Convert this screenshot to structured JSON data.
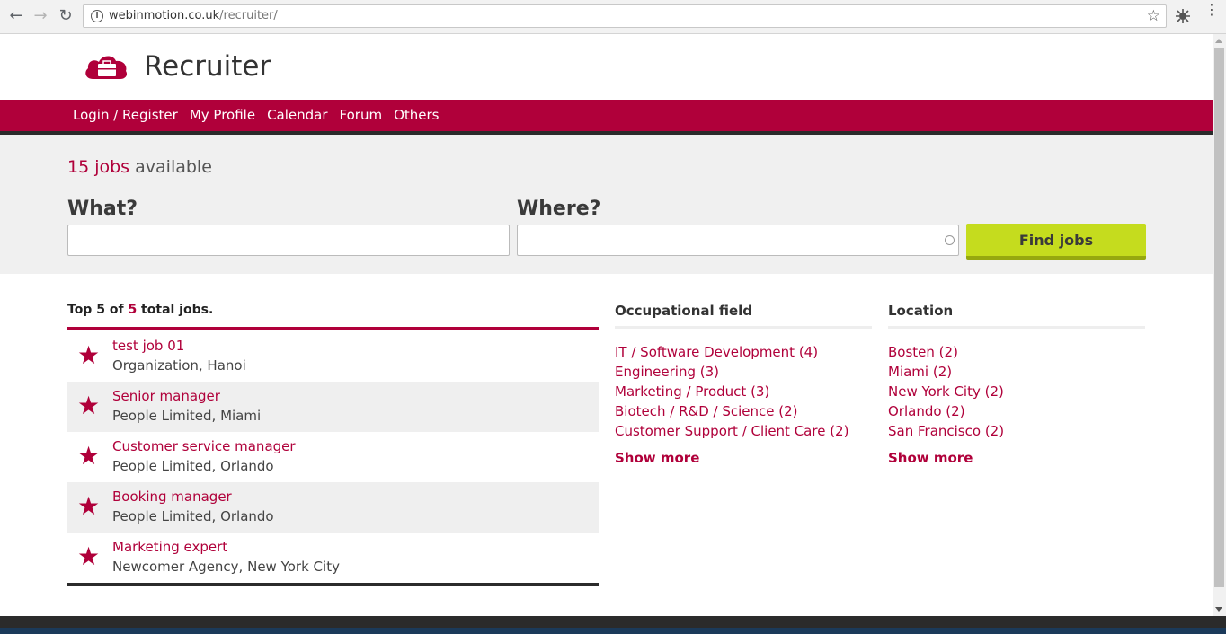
{
  "browser": {
    "url_domain": "webinmotion.co.uk",
    "url_path": "/recruiter/"
  },
  "header": {
    "title": "Recruiter"
  },
  "nav": {
    "items": [
      "Login / Register",
      "My Profile",
      "Calendar",
      "Forum",
      "Others"
    ]
  },
  "search": {
    "jobs_count": "15 jobs",
    "jobs_suffix": " available",
    "what_label": "What?",
    "where_label": "Where?",
    "what_value": "",
    "where_value": "",
    "find_button": "Find jobs"
  },
  "jobs": {
    "heading_prefix": "Top ",
    "top_n": "5",
    "heading_mid": " of ",
    "total": "5",
    "heading_suffix": " total jobs.",
    "items": [
      {
        "title": "test job 01",
        "sub": "Organization, Hanoi"
      },
      {
        "title": "Senior manager",
        "sub": "People Limited, Miami"
      },
      {
        "title": "Customer service manager",
        "sub": "People Limited, Orlando"
      },
      {
        "title": "Booking manager",
        "sub": "People Limited, Orlando"
      },
      {
        "title": "Marketing expert",
        "sub": "Newcomer Agency, New York City"
      }
    ]
  },
  "occupational": {
    "heading": "Occupational field",
    "items": [
      "IT / Software Development (4)",
      "Engineering (3)",
      "Marketing / Product (3)",
      "Biotech / R&D / Science (2)",
      "Customer Support / Client Care (2)"
    ],
    "show_more": "Show more"
  },
  "location": {
    "heading": "Location",
    "items": [
      "Bosten (2)",
      "Miami (2)",
      "New York City (2)",
      "Orlando (2)",
      "San Francisco (2)"
    ],
    "show_more": "Show more"
  },
  "colors": {
    "brand": "#b0003a",
    "button": "#c5dc1e"
  }
}
